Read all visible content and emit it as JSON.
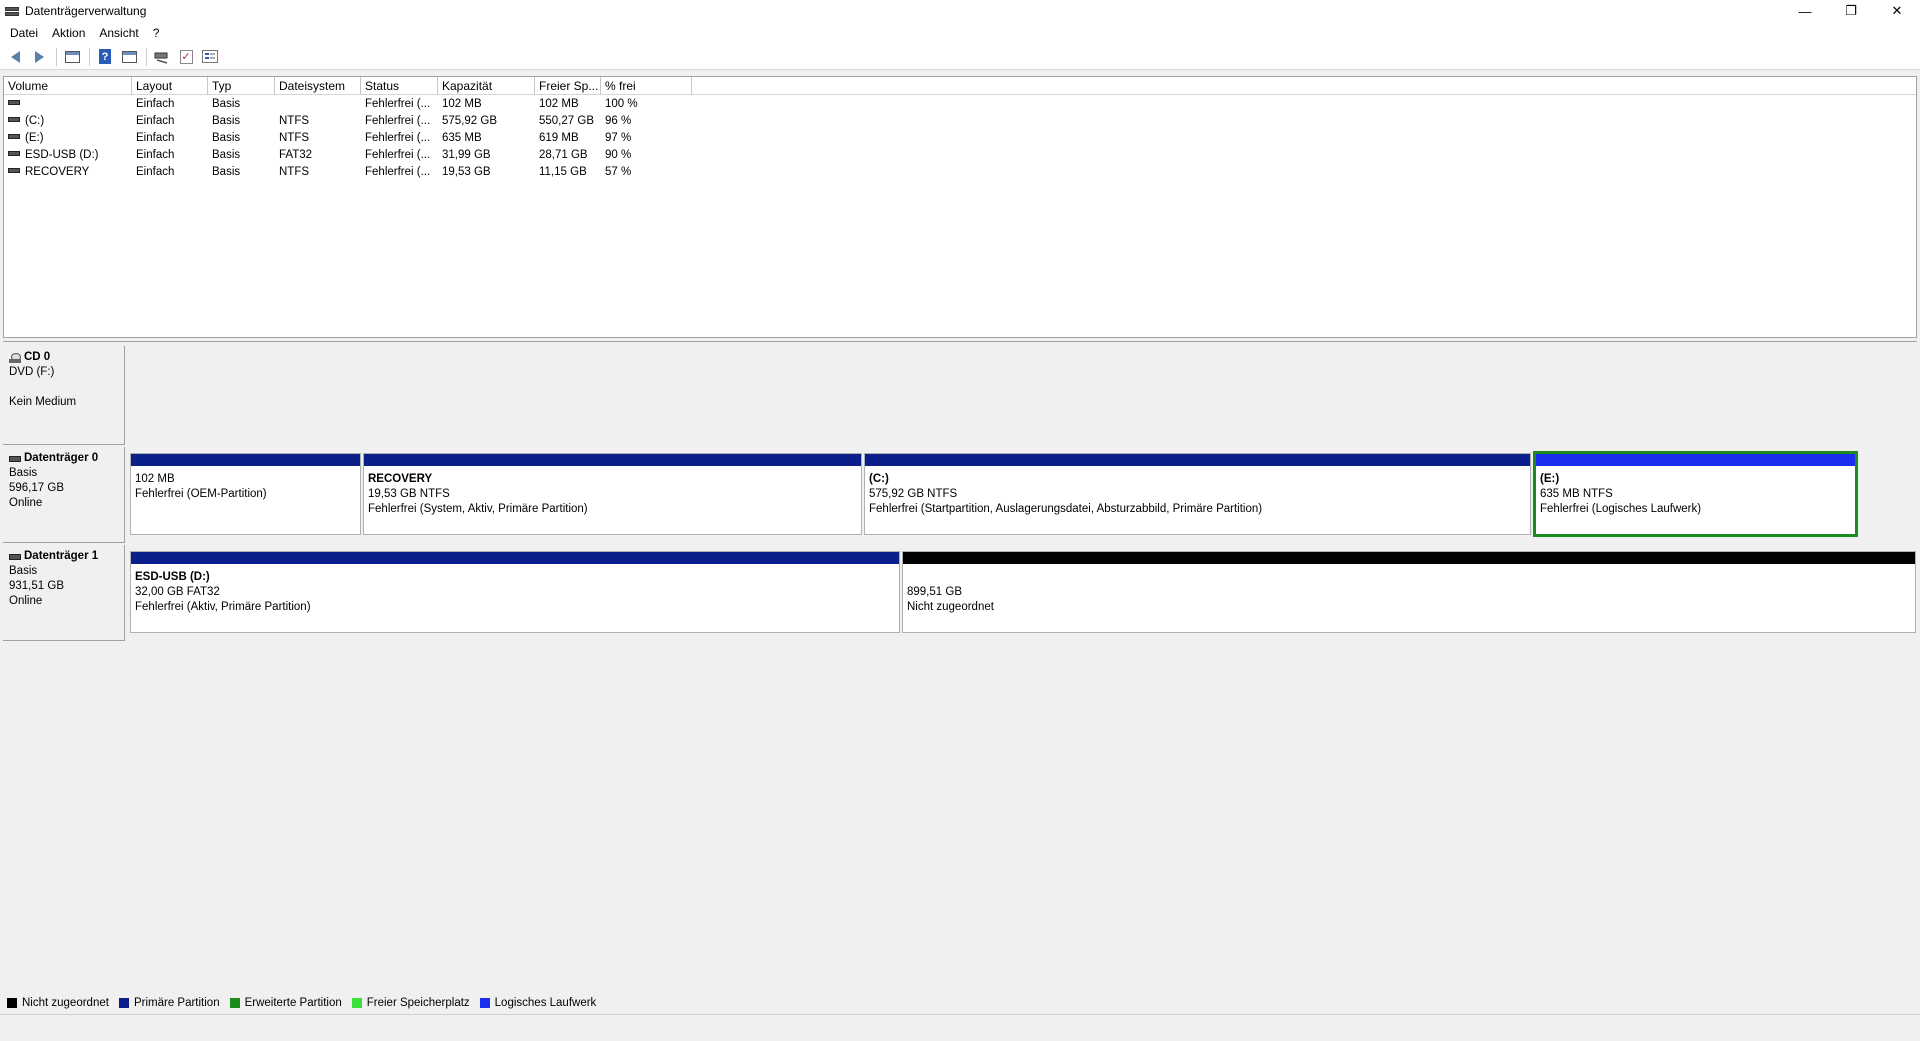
{
  "window": {
    "title": "Datenträgerverwaltung",
    "minimize": "—",
    "restore": "❐",
    "close": "✕"
  },
  "menu": [
    "Datei",
    "Aktion",
    "Ansicht",
    "?"
  ],
  "toolbar_icons": [
    "back-arrow-icon",
    "forward-arrow-icon",
    "console-tree-icon",
    "help-icon",
    "properties-icon",
    "connect-icon",
    "check-icon",
    "list-icon"
  ],
  "volume_table": {
    "columns": [
      "Volume",
      "Layout",
      "Typ",
      "Dateisystem",
      "Status",
      "Kapazität",
      "Freier Sp...",
      "% frei"
    ],
    "rows": [
      {
        "volume": "",
        "layout": "Einfach",
        "typ": "Basis",
        "fs": "",
        "status": "Fehlerfrei (...",
        "capacity": "102 MB",
        "free": "102 MB",
        "pct": "100 %"
      },
      {
        "volume": "(C:)",
        "layout": "Einfach",
        "typ": "Basis",
        "fs": "NTFS",
        "status": "Fehlerfrei (...",
        "capacity": "575,92 GB",
        "free": "550,27 GB",
        "pct": "96 %"
      },
      {
        "volume": "(E:)",
        "layout": "Einfach",
        "typ": "Basis",
        "fs": "NTFS",
        "status": "Fehlerfrei (...",
        "capacity": "635 MB",
        "free": "619 MB",
        "pct": "97 %"
      },
      {
        "volume": "ESD-USB (D:)",
        "layout": "Einfach",
        "typ": "Basis",
        "fs": "FAT32",
        "status": "Fehlerfrei (...",
        "capacity": "31,99 GB",
        "free": "28,71 GB",
        "pct": "90 %"
      },
      {
        "volume": "RECOVERY",
        "layout": "Einfach",
        "typ": "Basis",
        "fs": "NTFS",
        "status": "Fehlerfrei (...",
        "capacity": "19,53 GB",
        "free": "11,15 GB",
        "pct": "57 %"
      }
    ]
  },
  "disks": {
    "cd0": {
      "name": "CD 0",
      "line1": "DVD (F:)",
      "line2": "Kein Medium"
    },
    "disk0": {
      "name": "Datenträger 0",
      "type": "Basis",
      "size": "596,17 GB",
      "state": "Online",
      "partitions": [
        {
          "name": "",
          "size": "102 MB",
          "status": "Fehlerfrei (OEM-Partition)"
        },
        {
          "name": "RECOVERY",
          "size": "19,53 GB NTFS",
          "status": "Fehlerfrei (System, Aktiv, Primäre Partition)"
        },
        {
          "name": "(C:)",
          "size": "575,92 GB NTFS",
          "status": "Fehlerfrei (Startpartition, Auslagerungsdatei, Absturzabbild, Primäre Partition)"
        },
        {
          "name": "(E:)",
          "size": "635 MB NTFS",
          "status": "Fehlerfrei (Logisches Laufwerk)"
        }
      ]
    },
    "disk1": {
      "name": "Datenträger 1",
      "type": "Basis",
      "size": "931,51 GB",
      "state": "Online",
      "partitions": [
        {
          "name": "ESD-USB  (D:)",
          "size": "32,00 GB FAT32",
          "status": "Fehlerfrei (Aktiv, Primäre Partition)"
        },
        {
          "name": "",
          "size": "899,51 GB",
          "status": "Nicht zugeordnet"
        }
      ]
    }
  },
  "legend": [
    {
      "label": "Nicht zugeordnet",
      "color": "#000000"
    },
    {
      "label": "Primäre Partition",
      "color": "#0a1e8c"
    },
    {
      "label": "Erweiterte Partition",
      "color": "#1c8a1c"
    },
    {
      "label": "Freier Speicherplatz",
      "color": "#3ce03c"
    },
    {
      "label": "Logisches Laufwerk",
      "color": "#1a2ef0"
    }
  ],
  "colors": {
    "primary": "#0a1e8c",
    "logical": "#1a2ef0",
    "unallocated": "#000000",
    "selection": "#1c8a1c"
  }
}
